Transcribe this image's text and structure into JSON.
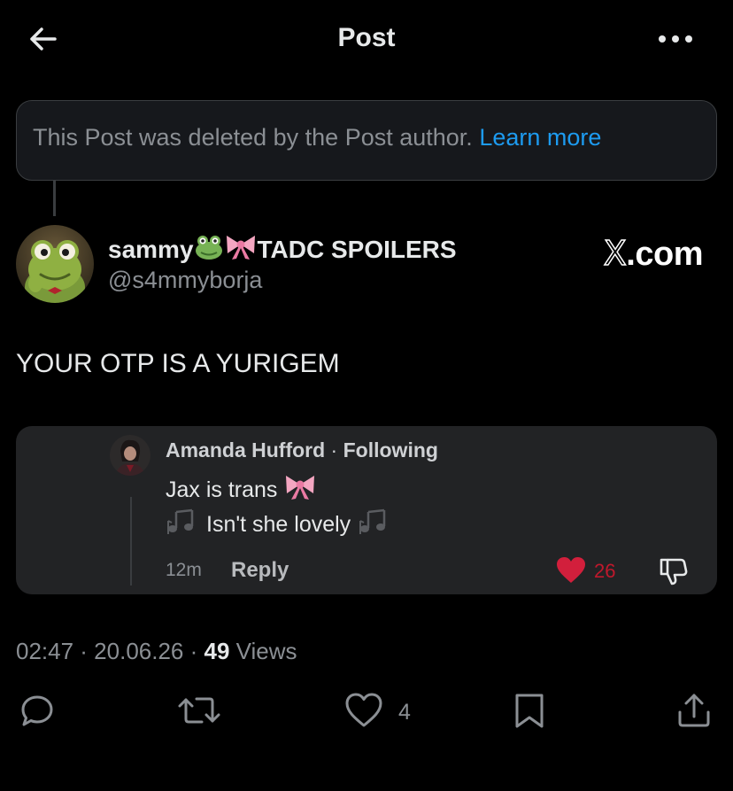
{
  "header": {
    "title": "Post"
  },
  "deleted_notice": {
    "text": "This Post was deleted by the Post author.",
    "link": "Learn more"
  },
  "post": {
    "author_name": "sammy",
    "author_name_suffix": "TADC SPOILERS",
    "author_handle": "@s4mmyborja",
    "badge": "X.com",
    "text": "YOUR OTP IS A YURIGEM",
    "timestamp": "02:47 · 20.06.26 · ",
    "views_count": "49",
    "views_label": " Views",
    "like_count": "4"
  },
  "quote": {
    "name": "Amanda Hufford",
    "separator": " · ",
    "following": "Following",
    "line1": "Jax is trans",
    "line2": "Isn't she lovely",
    "time": "12m",
    "reply_label": "Reply",
    "likes": "26"
  },
  "colors": {
    "background": "#000000",
    "accent_link": "#1d9bf0",
    "like_red": "#d21f3c",
    "muted_text": "#8b8f94"
  },
  "icons": {
    "back": "arrow-left-icon",
    "more": "more-horizontal-icon",
    "frog": "frog-emoji-icon",
    "ribbon": "ribbon-emoji-icon",
    "notes": "musical-notes-emoji-icon",
    "heart_filled": "heart-filled-icon",
    "dislike": "thumbs-down-icon",
    "reply": "reply-icon",
    "repost": "repost-icon",
    "like": "heart-icon",
    "bookmark": "bookmark-icon",
    "share": "share-icon"
  }
}
